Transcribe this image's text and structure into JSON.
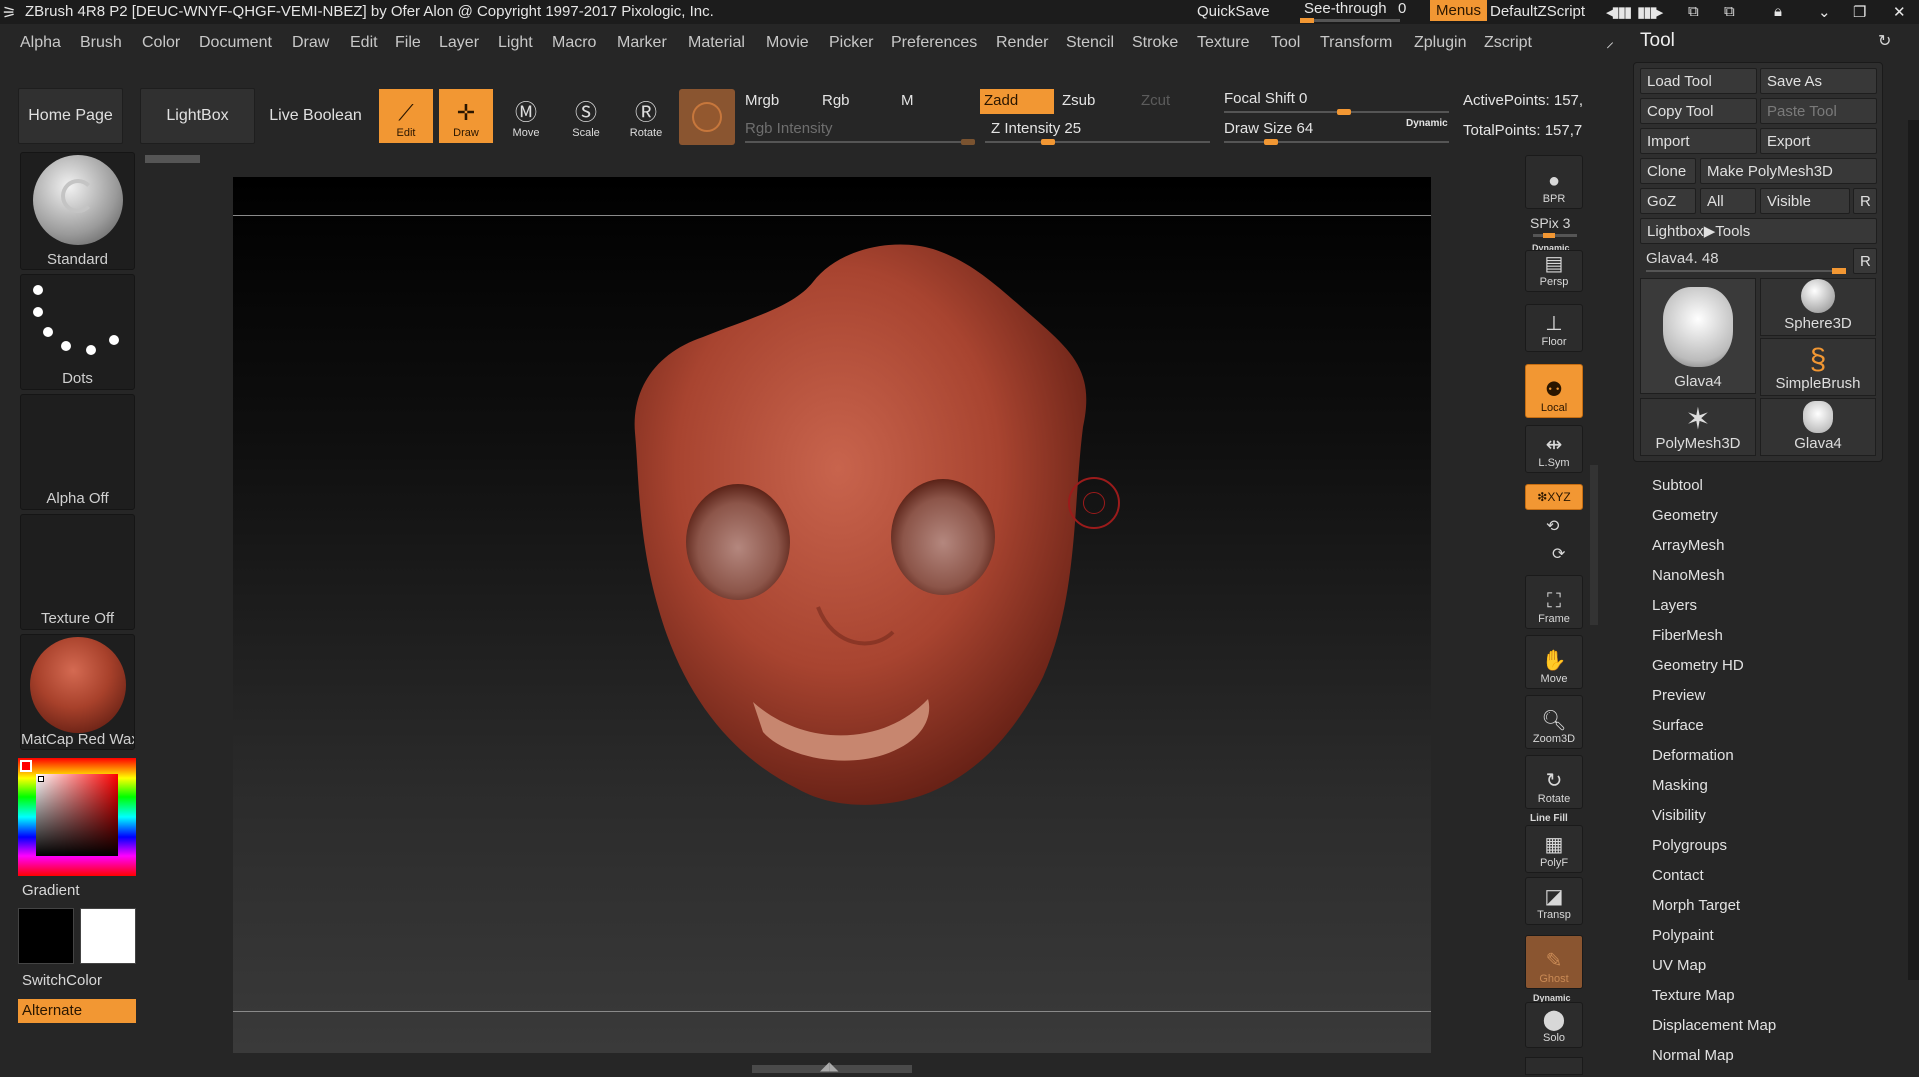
{
  "titlebar": {
    "title": "ZBrush 4R8 P2 [DEUC-WNYF-QHGF-VEMI-NBEZ] by Ofer Alon @ Copyright 1997-2017 Pixologic, Inc.",
    "quicksave": "QuickSave",
    "see_through_label": "See-through",
    "see_through_value": "0",
    "menus": "Menus",
    "script": "DefaultZScript"
  },
  "menubar": [
    "Alpha",
    "Brush",
    "Color",
    "Document",
    "Draw",
    "Edit",
    "File",
    "Layer",
    "Light",
    "Macro",
    "Marker",
    "Material",
    "Movie",
    "Picker",
    "Preferences",
    "Render",
    "Stencil",
    "Stroke",
    "Texture",
    "Tool",
    "Transform",
    "Zplugin",
    "Zscript"
  ],
  "toolbar": {
    "home_page": "Home Page",
    "lightbox": "LightBox",
    "live_boolean": "Live Boolean",
    "edit": "Edit",
    "draw": "Draw",
    "move": "Move",
    "scale": "Scale",
    "rotate": "Rotate",
    "mrgb": "Mrgb",
    "rgb": "Rgb",
    "m": "M",
    "rgb_intensity": "Rgb Intensity",
    "zadd": "Zadd",
    "zsub": "Zsub",
    "zcut": "Zcut",
    "z_intensity": "Z Intensity 25",
    "focal_shift": "Focal Shift 0",
    "draw_size": "Draw Size 64",
    "dynamic": "Dynamic",
    "active_points": "ActivePoints: 157,",
    "total_points": "TotalPoints: 157,7",
    "z_intensity_value": 25,
    "focal_shift_value": 0,
    "draw_size_value": 64
  },
  "left_panel": {
    "brush": "Standard",
    "stroke": "Dots",
    "alpha": "Alpha Off",
    "texture": "Texture Off",
    "material": "MatCap Red Wax",
    "gradient": "Gradient",
    "switch_color": "SwitchColor",
    "alternate": "Alternate"
  },
  "shelf": {
    "bpr": "BPR",
    "spix": "SPix 3",
    "dynamic": "Dynamic",
    "persp": "Persp",
    "floor": "Floor",
    "local": "Local",
    "lsym": "L.Sym",
    "xyz": "❇XYZ",
    "frame": "Frame",
    "move": "Move",
    "zoom3d": "Zoom3D",
    "rotate": "Rotate",
    "line_fill": "Line Fill",
    "polyf": "PolyF",
    "transp": "Transp",
    "ghost": "Ghost",
    "dynamic2": "Dynamic",
    "solo": "Solo"
  },
  "tool_panel": {
    "title": "Tool",
    "load_tool": "Load Tool",
    "save_as": "Save As",
    "copy_tool": "Copy Tool",
    "paste_tool": "Paste Tool",
    "import": "Import",
    "export": "Export",
    "clone": "Clone",
    "make_polymesh": "Make PolyMesh3D",
    "goz": "GoZ",
    "all": "All",
    "visible": "Visible",
    "r": "R",
    "lightbox_tools": "Lightbox▶Tools",
    "current_tool": "Glava4. 48",
    "thumbs": [
      "Glava4",
      "Sphere3D",
      "SimpleBrush",
      "PolyMesh3D",
      "Glava4"
    ],
    "sections": [
      "Subtool",
      "Geometry",
      "ArrayMesh",
      "NanoMesh",
      "Layers",
      "FiberMesh",
      "Geometry HD",
      "Preview",
      "Surface",
      "Deformation",
      "Masking",
      "Visibility",
      "Polygroups",
      "Contact",
      "Morph Target",
      "Polypaint",
      "UV Map",
      "Texture Map",
      "Displacement Map",
      "Normal Map"
    ]
  },
  "colors": {
    "accent": "#f29733",
    "material": "#a8412b",
    "background": "#262626"
  }
}
